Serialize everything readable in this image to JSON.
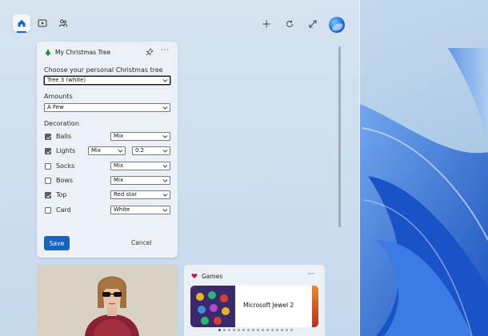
{
  "widget": {
    "title": "My Christmas Tree",
    "choose_label": "Choose your personal Christmas tree",
    "tree_value": "Tree 3 (white)",
    "amounts_label": "Amounts",
    "amounts_value": "A Few",
    "decoration_label": "Decoration",
    "items": [
      {
        "label": "Balls",
        "checked": true,
        "value": "Mix"
      },
      {
        "label": "Lights",
        "checked": true,
        "mode": "Mix",
        "value": "0.2"
      },
      {
        "label": "Socks",
        "checked": false,
        "value": "Mix"
      },
      {
        "label": "Bows",
        "checked": false,
        "value": "Mix"
      },
      {
        "label": "Top",
        "checked": true,
        "value": "Red star"
      },
      {
        "label": "Card",
        "checked": false,
        "value": "White"
      }
    ],
    "save_label": "Save",
    "cancel_label": "Cancel",
    "more_glyph": "···"
  },
  "games": {
    "title": "Games",
    "game_name": "Microsoft Jewel 2",
    "more_glyph": "···"
  },
  "colors": {
    "accent": "#1565c0",
    "panel": "#d6e4f0",
    "wallpaper_bloom": "#1f5fd0"
  },
  "icons": {
    "tab_home": "home-icon",
    "tab_video": "play-icon",
    "tab_people": "people-icon",
    "add": "plus-icon",
    "refresh": "refresh-icon",
    "expand": "expand-icon",
    "pin": "pin-icon"
  }
}
